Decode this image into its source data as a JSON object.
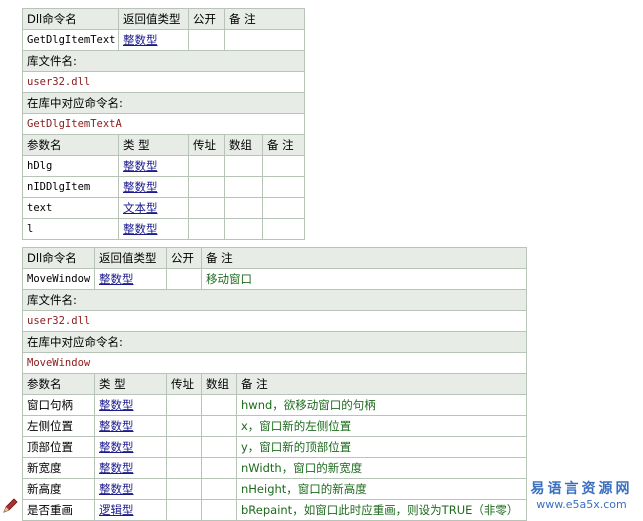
{
  "labels": {
    "dll_name": "Dll命令名",
    "return_type": "返回值类型",
    "public": "公开",
    "remark": "备 注",
    "lib_file": "库文件名:",
    "lib_cmd": "在库中对应命令名:",
    "param_name": "参数名",
    "type": "类 型",
    "by_ref": "传址",
    "array": "数组"
  },
  "commands": [
    {
      "name": "GetDlgItemText",
      "return_type": "整数型",
      "public": "",
      "remark": "",
      "lib_file": "user32.dll",
      "lib_cmd": "GetDlgItemTextA",
      "params": [
        {
          "name": "hDlg",
          "type": "整数型",
          "by_ref": "",
          "array": "",
          "remark": ""
        },
        {
          "name": "nIDDlgItem",
          "type": "整数型",
          "by_ref": "",
          "array": "",
          "remark": ""
        },
        {
          "name": "text",
          "type": "文本型",
          "by_ref": "",
          "array": "",
          "remark": ""
        },
        {
          "name": "l",
          "type": "整数型",
          "by_ref": "",
          "array": "",
          "remark": ""
        }
      ]
    },
    {
      "name": "MoveWindow",
      "return_type": "整数型",
      "public": "",
      "remark": "移动窗口",
      "lib_file": "user32.dll",
      "lib_cmd": "MoveWindow",
      "params": [
        {
          "name": "窗口句柄",
          "type": "整数型",
          "by_ref": "",
          "array": "",
          "remark": "hwnd，欲移动窗口的句柄"
        },
        {
          "name": "左侧位置",
          "type": "整数型",
          "by_ref": "",
          "array": "",
          "remark": "x，窗口新的左侧位置"
        },
        {
          "name": "顶部位置",
          "type": "整数型",
          "by_ref": "",
          "array": "",
          "remark": "y，窗口新的顶部位置"
        },
        {
          "name": "新宽度",
          "type": "整数型",
          "by_ref": "",
          "array": "",
          "remark": "nWidth，窗口的新宽度"
        },
        {
          "name": "新高度",
          "type": "整数型",
          "by_ref": "",
          "array": "",
          "remark": "nHeight，窗口的新高度"
        },
        {
          "name": "是否重画",
          "type": "逻辑型",
          "by_ref": "",
          "array": "",
          "remark": "bRepaint，如窗口此时应重画，则设为TRUE（非零）"
        }
      ]
    }
  ],
  "watermark": {
    "line1": "易语言资源网",
    "line2": "www.e5a5x.com"
  },
  "colors": {
    "header_bg": "#e7ece7",
    "border": "#b9c4b9",
    "lib_text": "#8b1a1a",
    "type_link": "#1a1a8c",
    "remark_text": "#1c6a1c",
    "watermark": "#3a6fc0"
  }
}
